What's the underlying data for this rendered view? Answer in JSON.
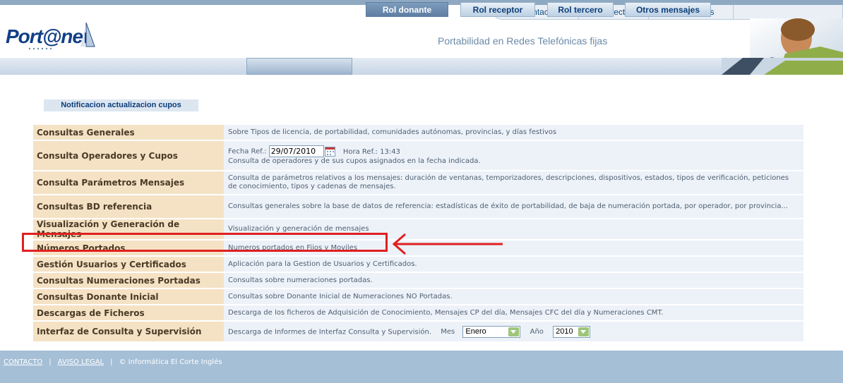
{
  "top_nav": [
    "presentación",
    "proyecto",
    "aplicaciones"
  ],
  "logo": {
    "text": "Port@net"
  },
  "header": {
    "subtitle": "Portabilidad en Redes Telefónicas fijas"
  },
  "menu": {
    "tabs": [
      {
        "label": "Rol donante",
        "active": true
      },
      {
        "label": "Rol receptor",
        "active": false
      },
      {
        "label": "Rol tercero",
        "active": false
      },
      {
        "label": "Otros mensajes",
        "active": false
      }
    ]
  },
  "notification_button": "Notificacion actualizacion cupos",
  "rows": [
    {
      "title": "Consultas Generales",
      "description": "Sobre Tipos de licencia, de portabilidad, comunidades autónomas, provincias, y días festivos"
    },
    {
      "title": "Consulta Operadores y Cupos",
      "fecha_label": "Fecha Ref.:",
      "fecha_value": "29/07/2010",
      "hora_label": "Hora Ref.: 13:43",
      "description": "Consulta de operadores y de sus cupos asignados en la fecha indicada."
    },
    {
      "title": "Consulta Parámetros Mensajes",
      "description": "Consulta de parámetros relativos a los mensajes: duración de ventanas, temporizadores, descripciones, dispositivos, estados, tipos de verificación, peticiones de conocimiento, tipos y cadenas de mensajes."
    },
    {
      "title": "Consultas BD referencia",
      "description": "Consultas generales sobre la base de datos de referencia: estadísticas de éxito de portabilidad, de baja de numeración portada, por operador, por provincia..."
    },
    {
      "title": "Visualización y Generación de Mensajes",
      "description": "Visualización y generación de mensajes"
    },
    {
      "title": "Números Portados",
      "description": "Numeros portados en Fijos y Moviles"
    },
    {
      "title": "Gestión Usuarios y Certificados",
      "description": "Aplicación para la Gestion de Usuarios y Certificados."
    },
    {
      "title": "Consultas Numeraciones Portadas",
      "description": "Consultas sobre numeraciones portadas."
    },
    {
      "title": "Consultas Donante Inicial",
      "description": "Consultas sobre Donante Inicial de Numeraciones NO Portadas."
    },
    {
      "title": "Descargas de Ficheros",
      "description": "Descarga de los ficheros de Adquisición de Conocimiento, Mensajes CP del día, Mensajes CFC del día y Numeraciones CMT."
    },
    {
      "title": "Interfaz de Consulta y Supervisión",
      "description": "Descarga de Informes de Interfaz Consulta y Supervisión.",
      "mes_label": "Mes",
      "mes_value": "Enero",
      "anio_label": "Año",
      "anio_value": "2010"
    }
  ],
  "footer": {
    "contacto": "CONTACTO",
    "aviso_legal": "AVISO LEGAL",
    "copyright": "© Informática El Corte Inglés"
  },
  "colors": {
    "row_title_bg": "#f5e2c4",
    "row_desc_bg": "#edf2f9",
    "highlight": "#e02020",
    "footer_bg": "#a5bfd6"
  }
}
